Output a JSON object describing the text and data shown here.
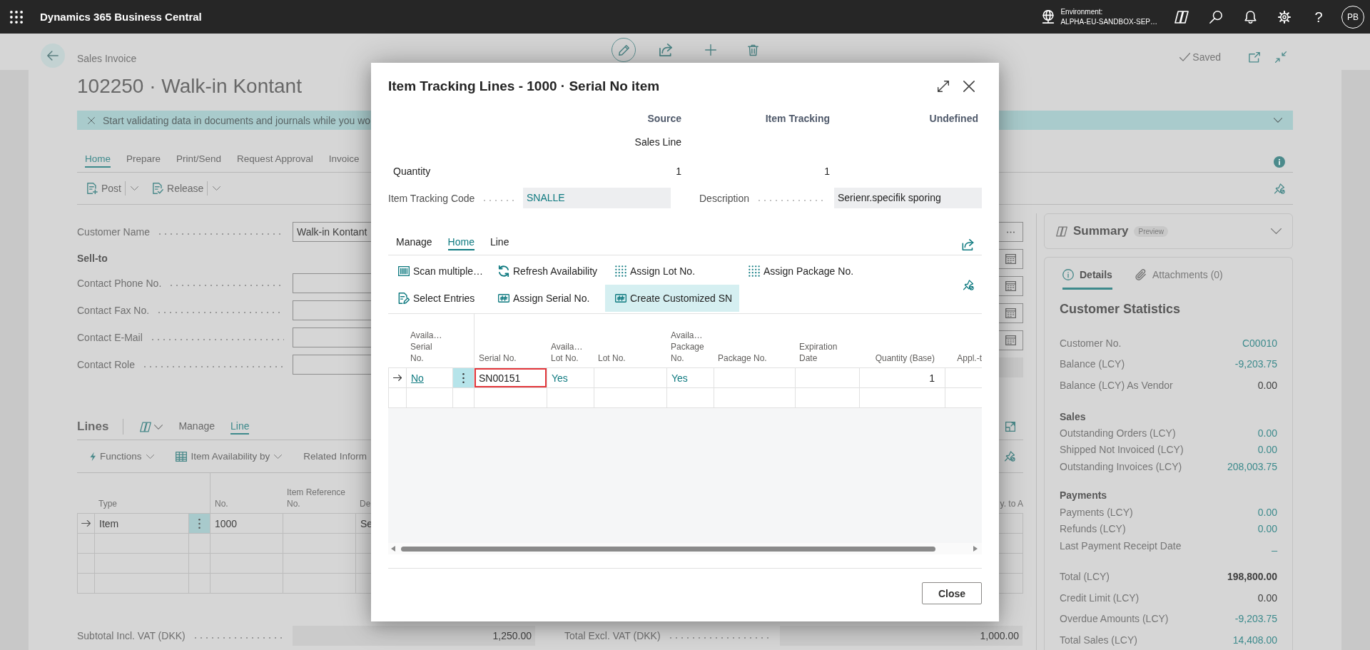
{
  "top_bar": {
    "app_title": "Dynamics 365 Business Central",
    "environment_label": "Environment:",
    "environment_name": "ALPHA-EU-SANDBOX-SEP…",
    "help_label": "?",
    "avatar_initials": "PB"
  },
  "page": {
    "breadcrumb": "Sales Invoice",
    "title": "102250 · Walk-in Kontant",
    "status": "Saved",
    "banner": "Start validating data in documents and journals while you wo",
    "action_tabs": [
      {
        "label": "Home",
        "selected": true
      },
      {
        "label": "Prepare",
        "selected": false
      },
      {
        "label": "Print/Send",
        "selected": false
      },
      {
        "label": "Request Approval",
        "selected": false
      },
      {
        "label": "Invoice",
        "selected": false
      }
    ],
    "actions": [
      {
        "label": "Post",
        "menu": true
      },
      {
        "label": "Release",
        "menu": true
      }
    ],
    "general": {
      "left": [
        {
          "kind": "field",
          "label": "Customer Name",
          "value": "Walk-in Kontant"
        },
        {
          "kind": "heading",
          "label": "Sell-to"
        },
        {
          "kind": "field",
          "label": "Contact Phone No."
        },
        {
          "kind": "field",
          "label": "Contact Fax No."
        },
        {
          "kind": "field",
          "label": "Contact E-Mail"
        },
        {
          "kind": "field",
          "label": "Contact Role"
        }
      ],
      "right": [
        {
          "kind": "lookup"
        },
        {
          "kind": "date"
        },
        {
          "kind": "date"
        },
        {
          "kind": "date"
        },
        {
          "kind": "date"
        },
        {
          "kind": "read-only"
        }
      ]
    },
    "lines": {
      "title": "Lines",
      "tabs": [
        {
          "label": "Manage",
          "selected": false
        },
        {
          "label": "Line",
          "selected": true
        }
      ],
      "actions": [
        {
          "label": "Functions",
          "menu": true
        },
        {
          "label": "Item Availability by",
          "menu": true
        },
        {
          "label": "Related Inform"
        }
      ],
      "columns": [
        "Type",
        "No.",
        "Item Reference\nNo.",
        "De"
      ],
      "far_columns": [
        "y. to A"
      ],
      "rows": [
        {
          "selected": true,
          "type": "Item",
          "no": "1000",
          "column_4": "Se"
        },
        {
          "selected": false
        },
        {
          "selected": false
        },
        {
          "selected": false
        }
      ]
    },
    "totals": [
      {
        "label": "Subtotal Incl. VAT (DKK)",
        "value": "1,250.00"
      },
      {
        "label": "Total Excl. VAT (DKK)",
        "value": "1,000.00"
      }
    ]
  },
  "factbox": {
    "summary": {
      "title": "Summary",
      "badge": "Preview"
    },
    "tabs": [
      {
        "label": "Details",
        "selected": true
      },
      {
        "label": "Attachments (0)",
        "selected": false
      }
    ],
    "statistics": {
      "title": "Customer Statistics",
      "groups": [
        {
          "rows": [
            {
              "label": "Customer No.",
              "value": "C00010",
              "link": true
            },
            {
              "label": "Balance (LCY)",
              "value": "-9,203.75",
              "link": true
            },
            {
              "label": "Balance (LCY) As Vendor",
              "value": "0.00",
              "link": false
            }
          ]
        },
        {
          "heading": "Sales",
          "rows": [
            {
              "label": "Outstanding Orders (LCY)",
              "value": "0.00",
              "link": true
            },
            {
              "label": "Shipped Not Invoiced (LCY)",
              "value": "0.00",
              "link": true
            },
            {
              "label": "Outstanding Invoices (LCY)",
              "value": "208,003.75",
              "link": true
            }
          ]
        },
        {
          "heading": "Payments",
          "rows": [
            {
              "label": "Payments (LCY)",
              "value": "0.00",
              "link": true
            },
            {
              "label": "Refunds (LCY)",
              "value": "0.00",
              "link": true
            },
            {
              "label": "Last Payment Receipt Date",
              "value": "_",
              "link": true
            }
          ]
        },
        {
          "rows": [
            {
              "label": "Total (LCY)",
              "value": "198,800.00",
              "link": false,
              "emphasized": true
            },
            {
              "label": "Credit Limit (LCY)",
              "value": "0.00",
              "link": false
            },
            {
              "label": "Overdue Amounts (LCY)",
              "value": "-9,203.75",
              "link": true
            },
            {
              "label": "Total Sales (LCY)",
              "value": "14,408.00",
              "link": true
            }
          ]
        }
      ]
    }
  },
  "dialog": {
    "title": "Item Tracking Lines - 1000 · Serial No item",
    "summary": {
      "columns": [
        "Source",
        "Item Tracking",
        "Undefined"
      ],
      "rows": [
        {
          "values": [
            "Sales Line"
          ]
        },
        {
          "label": "Quantity",
          "values": [
            "1",
            "1"
          ]
        }
      ]
    },
    "fields": [
      {
        "label": "Item Tracking Code",
        "value": "SNALLE",
        "link": true
      },
      {
        "label": "Description",
        "value": "Serienr.specifik sporing",
        "link": false
      }
    ],
    "tabs": [
      {
        "label": "Manage",
        "selected": false
      },
      {
        "label": "Home",
        "selected": true
      },
      {
        "label": "Line",
        "selected": false
      }
    ],
    "actions": [
      {
        "label": "Scan multiple…",
        "selected": false
      },
      {
        "label": "Refresh Availability",
        "selected": false
      },
      {
        "label": "Assign Lot No.",
        "selected": false
      },
      {
        "label": "Assign Package No.",
        "selected": false
      },
      {
        "label": "Select Entries",
        "selected": false
      },
      {
        "label": "Assign Serial No.",
        "selected": false
      },
      {
        "label": "Create Customized SN",
        "selected": true
      }
    ],
    "grid": {
      "columns": [
        {
          "label": "Availa…\nSerial\nNo.",
          "kind": "drilldown"
        },
        {
          "label": "Serial No.",
          "kind": "text"
        },
        {
          "label": "Availa…\nLot No.",
          "kind": "link"
        },
        {
          "label": "Lot No.",
          "kind": "text"
        },
        {
          "label": "Availa…\nPackage\nNo.",
          "kind": "link"
        },
        {
          "label": "Package No.",
          "kind": "text"
        },
        {
          "label": "Expiration\nDate",
          "kind": "text"
        },
        {
          "label": "Quantity (Base)",
          "kind": "number"
        },
        {
          "label": "Appl.-t",
          "kind": "number"
        }
      ],
      "rows": [
        {
          "selected": true,
          "serial_no_framed": true,
          "available_serial_no": "No",
          "serial_no": "SN00151",
          "available_lot_no": "Yes",
          "available_package_no": "Yes",
          "quantity_base": "1"
        },
        {
          "selected": false,
          "serial_no_framed": false
        }
      ]
    },
    "close_label": "Close"
  }
}
